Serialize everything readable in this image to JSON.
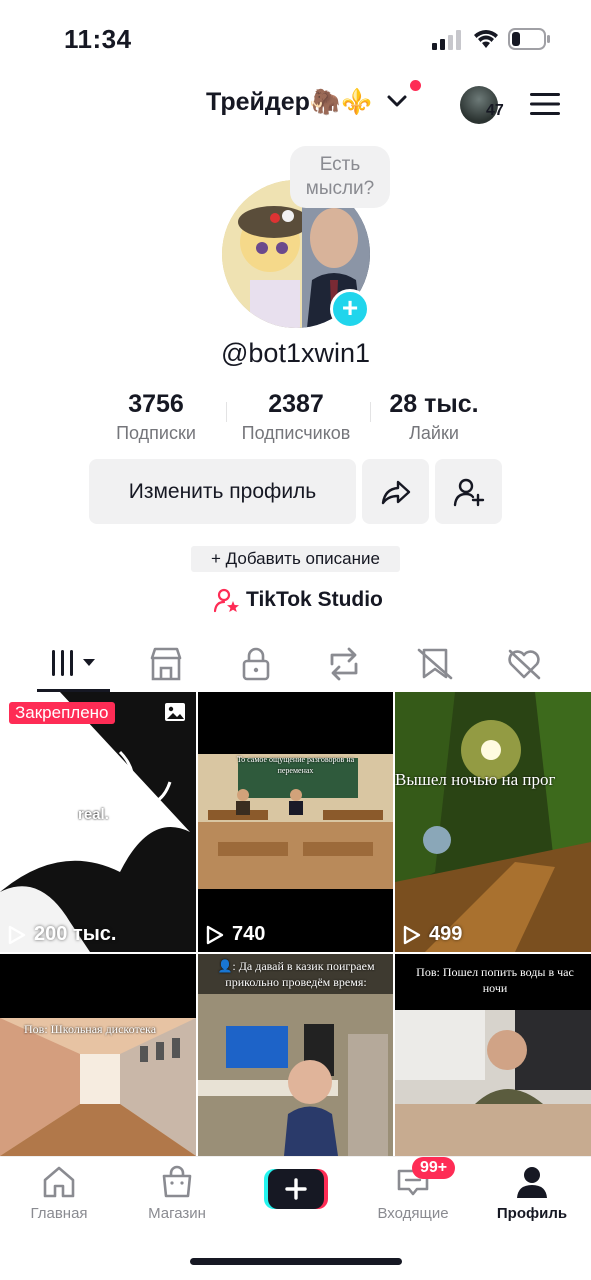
{
  "status_bar": {
    "time": "11:34"
  },
  "header": {
    "title": "Трейдер🦣⚜️",
    "following_count": "47"
  },
  "bubble": {
    "text_line1": "Есть",
    "text_line2": "мысли?"
  },
  "profile": {
    "handle": "@bot1xwin1",
    "stats": [
      {
        "value": "3756",
        "label": "Подписки"
      },
      {
        "value": "2387",
        "label": "Подписчиков"
      },
      {
        "value": "28 тыс.",
        "label": "Лайки"
      }
    ],
    "edit_button": "Изменить профиль",
    "add_description": "+ Добавить описание",
    "studio_label": "TikTok Studio"
  },
  "grid": {
    "pinned_label": "Закреплено",
    "videos": [
      {
        "views": "200 тыс.",
        "caption": "real."
      },
      {
        "views": "740",
        "caption": "То самое ощущение разговоров на переменах"
      },
      {
        "views": "499",
        "caption": "Вышел ночью на прог"
      },
      {
        "views": "",
        "caption": "Пов: Школьная дискотека"
      },
      {
        "views": "",
        "caption": "👤: Да давай в казик поиграем прикольно проведём время:"
      },
      {
        "views": "",
        "caption": "Пов: Пошел попить воды в час ночи"
      }
    ]
  },
  "bottom_nav": {
    "home": "Главная",
    "shop": "Магазин",
    "inbox": "Входящие",
    "inbox_badge": "99+",
    "profile": "Профиль"
  },
  "colors": {
    "accent": "#fe2c55",
    "cyan": "#20d5ec",
    "text": "#161823",
    "muted": "#75767b"
  }
}
